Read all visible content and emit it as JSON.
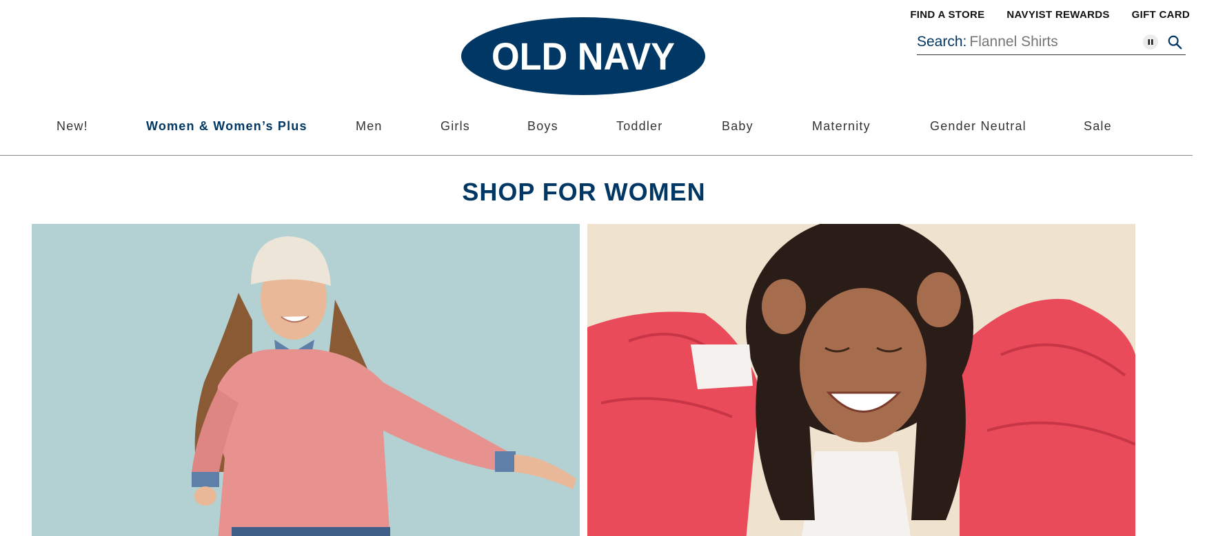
{
  "brand": {
    "logo_text": "OLD NAVY",
    "primary_color": "#003764"
  },
  "utility_links": [
    {
      "label": "FIND A STORE"
    },
    {
      "label": "NAVYIST REWARDS"
    },
    {
      "label": "GIFT CARD"
    }
  ],
  "search": {
    "label": "Search:",
    "placeholder": "Flannel Shirts",
    "pause_icon": "pause-icon",
    "submit_icon": "search-icon"
  },
  "main_nav": {
    "active_index": 1,
    "items": [
      {
        "label": "New!"
      },
      {
        "label": "Women & Women’s Plus"
      },
      {
        "label": "Men"
      },
      {
        "label": "Girls"
      },
      {
        "label": "Boys"
      },
      {
        "label": "Toddler"
      },
      {
        "label": "Baby"
      },
      {
        "label": "Maternity"
      },
      {
        "label": "Gender Neutral"
      },
      {
        "label": "Sale"
      }
    ]
  },
  "section": {
    "title": "SHOP FOR WOMEN"
  },
  "tiles": [
    {
      "background": "#b3d1d3",
      "garment_color": "#e7928e"
    },
    {
      "background": "#efe2cf",
      "garment_color": "#e94b5a"
    }
  ]
}
